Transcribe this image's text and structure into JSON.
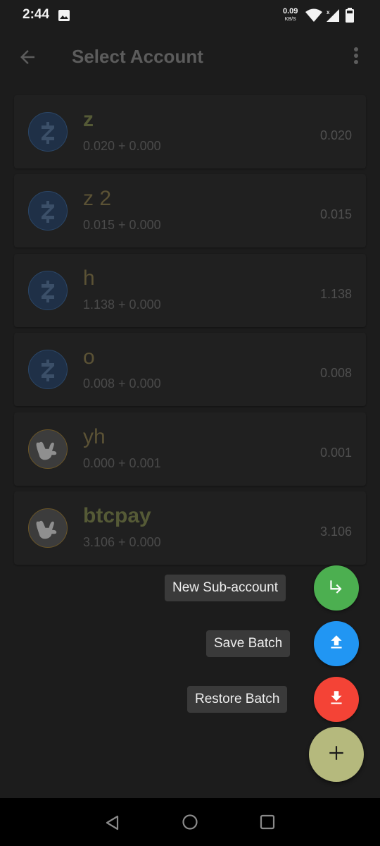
{
  "status_bar": {
    "time": "2:44",
    "net_speed_value": "0.09",
    "net_speed_unit": "KB/S",
    "icons": [
      "image-icon",
      "wifi-icon",
      "signal-icon",
      "battery-icon"
    ]
  },
  "app_bar": {
    "title": "Select Account",
    "back_icon": "arrow-back-icon",
    "menu_icon": "more-vert-icon"
  },
  "accounts": [
    {
      "name": "z",
      "detail": "0.020 + 0.000",
      "total": "0.020",
      "icon": "zcash-icon"
    },
    {
      "name": "z 2",
      "detail": "0.015 + 0.000",
      "total": "0.015",
      "icon": "zcash-icon"
    },
    {
      "name": "h",
      "detail": "1.138 + 0.000",
      "total": "1.138",
      "icon": "zcash-icon"
    },
    {
      "name": "o",
      "detail": "0.008 + 0.000",
      "total": "0.008",
      "icon": "zcash-icon"
    },
    {
      "name": "yh",
      "detail": "0.000 + 0.001",
      "total": "0.001",
      "icon": "shaka-hand-icon"
    },
    {
      "name": "btcpay",
      "detail": "3.106 + 0.000",
      "total": "3.106",
      "icon": "shaka-hand-icon"
    }
  ],
  "speed_dial": {
    "actions": [
      {
        "label": "New Sub-account",
        "icon": "subdirectory-arrow-icon",
        "color": "#4caf50"
      },
      {
        "label": "Save Batch",
        "icon": "upload-icon",
        "color": "#2196f3"
      },
      {
        "label": "Restore Batch",
        "icon": "download-icon",
        "color": "#f44336"
      }
    ],
    "main_fab": {
      "icon": "plus-icon",
      "color": "#b5b97d"
    }
  },
  "nav_bar": {
    "icons": [
      "nav-back-icon",
      "nav-home-icon",
      "nav-recents-icon"
    ]
  }
}
